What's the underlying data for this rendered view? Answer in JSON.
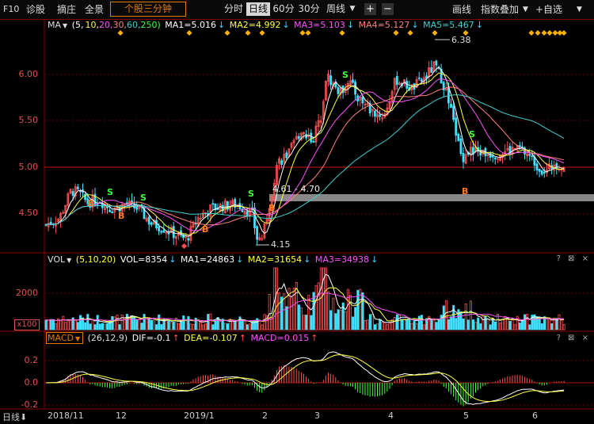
{
  "toolbar": {
    "f10": "F10",
    "diagnose": "诊股",
    "select": "摘庄",
    "panorama": "全景",
    "three_minute": "个股三分钟",
    "periods": [
      "分时",
      "日线",
      "60分",
      "30分",
      "周线"
    ],
    "active_period": "日线",
    "plus": "+",
    "minus": "−",
    "draw": "画线",
    "index_overlay": "指数叠加",
    "add_watch": "+自选"
  },
  "ma_legend": {
    "name": "MA",
    "params_prefix": "(5,",
    "p10": "10,",
    "p20": "20,",
    "p30": "30,",
    "p60": "60,",
    "p250": "250)",
    "ma1": "MA1=5.016",
    "ma2": "MA2=4.992",
    "ma3": "MA3=5.103",
    "ma4": "MA4=5.127",
    "ma5": "MA5=5.467"
  },
  "price_axis": [
    "6.00",
    "5.50",
    "5.00",
    "4.50"
  ],
  "annotations": {
    "high": "6.38",
    "low": "4.15",
    "range": "4.61 - 4.70",
    "signal_s": "S",
    "signal_b": "B"
  },
  "vol_legend": {
    "name": "VOL",
    "params": "(5,10,20)",
    "vol": "VOL=8354",
    "ma1": "MA1=24863",
    "ma2": "MA2=31654",
    "ma3": "MA3=34938"
  },
  "vol_axis": {
    "v2000": "2000",
    "unit": "x100"
  },
  "macd_legend": {
    "name": "MACD",
    "params": "(26,12,9)",
    "dif": "DIF=-0.1",
    "dea": "DEA=-0.107",
    "macd": "MACD=0.015"
  },
  "macd_axis": [
    "0.2",
    "0.0",
    "-0.2"
  ],
  "xaxis": {
    "period_label": "日线",
    "labels": [
      "2018/11",
      "12",
      "2019/1",
      "2",
      "3",
      "4",
      "5",
      "6"
    ]
  },
  "panel_icons": "? ⊠ ×",
  "colors": {
    "up": "#ff5050",
    "down": "#40e0ff",
    "ma1": "#ffffff",
    "ma2": "#ffff40",
    "ma3": "#ff50ff",
    "ma4": "#ff8080",
    "ma5": "#40d0d0"
  }
}
